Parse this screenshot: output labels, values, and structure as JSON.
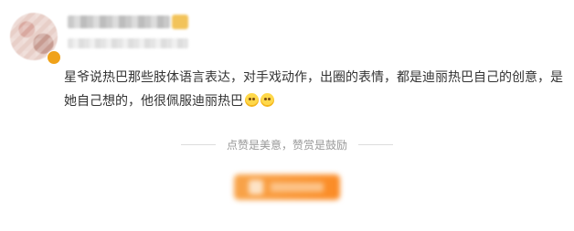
{
  "comment": {
    "text": "星爷说热巴那些肢体语言表达，对手戏动作，出圈的表情，都是迪丽热巴自己的创意，是她自己想的，他很佩服迪丽热巴",
    "emoji_icons": [
      "crying-face-icon",
      "grin-face-icon"
    ]
  },
  "divider": {
    "text": "点赞是美意，赞赏是鼓励"
  },
  "colors": {
    "text": "#333333",
    "muted": "#999999",
    "button_gradient_start": "#f8a44a",
    "button_gradient_end": "#fb8b25",
    "vip_badge": "#f0a21a"
  }
}
